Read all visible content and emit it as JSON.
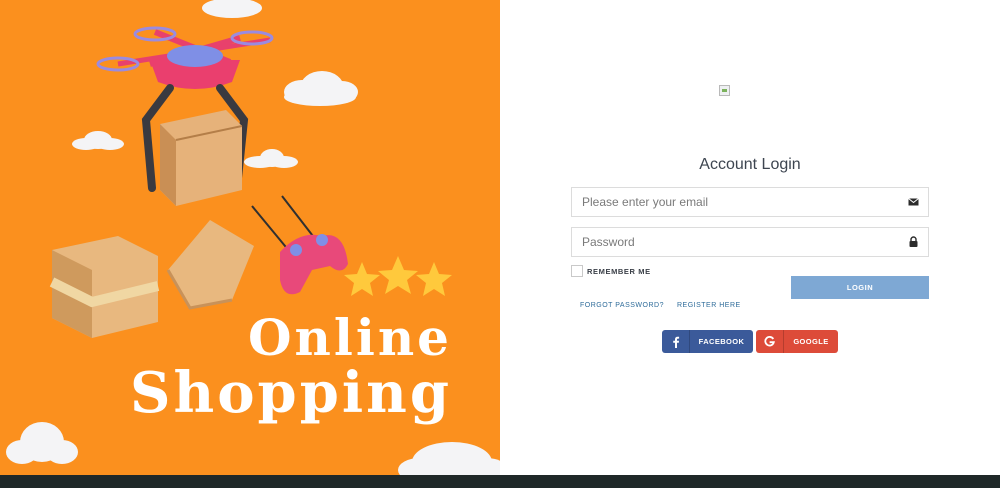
{
  "hero": {
    "title_line1": "Online",
    "title_line2": "Shopping",
    "background_color": "#fb901e"
  },
  "login": {
    "logo_icon": "broken-image-icon",
    "title": "Account Login",
    "email": {
      "value": "",
      "placeholder": "Please enter your email",
      "icon": "envelope-icon"
    },
    "password": {
      "value": "",
      "placeholder": "Password",
      "icon": "lock-icon"
    },
    "remember_label": "REMEMBER ME",
    "remember_checked": false,
    "login_button": "LOGIN",
    "login_button_color": "#7ea8d4",
    "forgot_link": "FORGOT PASSWORD?",
    "register_link": "REGISTER HERE",
    "social": {
      "facebook": {
        "label": "FACEBOOK",
        "icon": "facebook-icon",
        "color": "#3b5a9a"
      },
      "google": {
        "label": "GOOGLE",
        "icon": "google-icon",
        "color": "#dd4b39"
      }
    }
  },
  "footer": {
    "bar_color": "#1f2828"
  }
}
